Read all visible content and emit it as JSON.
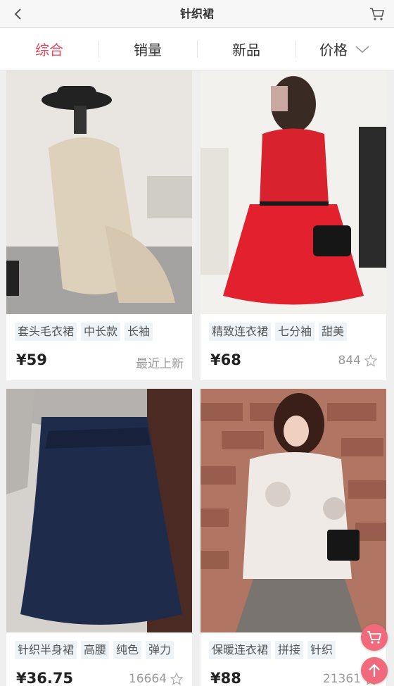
{
  "header": {
    "title": "针织裙",
    "back_icon": "back-chevron-icon",
    "cart_icon": "shopping-cart-icon"
  },
  "sort_tabs": [
    {
      "label": "综合",
      "active": true
    },
    {
      "label": "销量",
      "active": false
    },
    {
      "label": "新品",
      "active": false
    },
    {
      "label": "价格",
      "active": false,
      "icon": "chevron-down-icon"
    }
  ],
  "products": [
    {
      "tags": [
        "套头毛衣裙",
        "中长款",
        "长袖"
      ],
      "price": "¥59",
      "meta": "最近上新",
      "show_star": false
    },
    {
      "tags": [
        "精致连衣裙",
        "七分袖",
        "甜美"
      ],
      "price": "¥68",
      "meta": "844",
      "show_star": true
    },
    {
      "tags": [
        "针织半身裙",
        "高腰",
        "纯色",
        "弹力"
      ],
      "price": "¥36.75",
      "meta": "16664",
      "show_star": true
    },
    {
      "tags": [
        "保暖连衣裙",
        "拼接",
        "针织"
      ],
      "price": "¥88",
      "meta": "21361",
      "show_star": true
    }
  ],
  "floating": {
    "cart_icon": "cart-icon",
    "top_icon": "arrow-up-icon"
  },
  "colors": {
    "accent": "#e8475f",
    "fab": "#f06a7c"
  }
}
